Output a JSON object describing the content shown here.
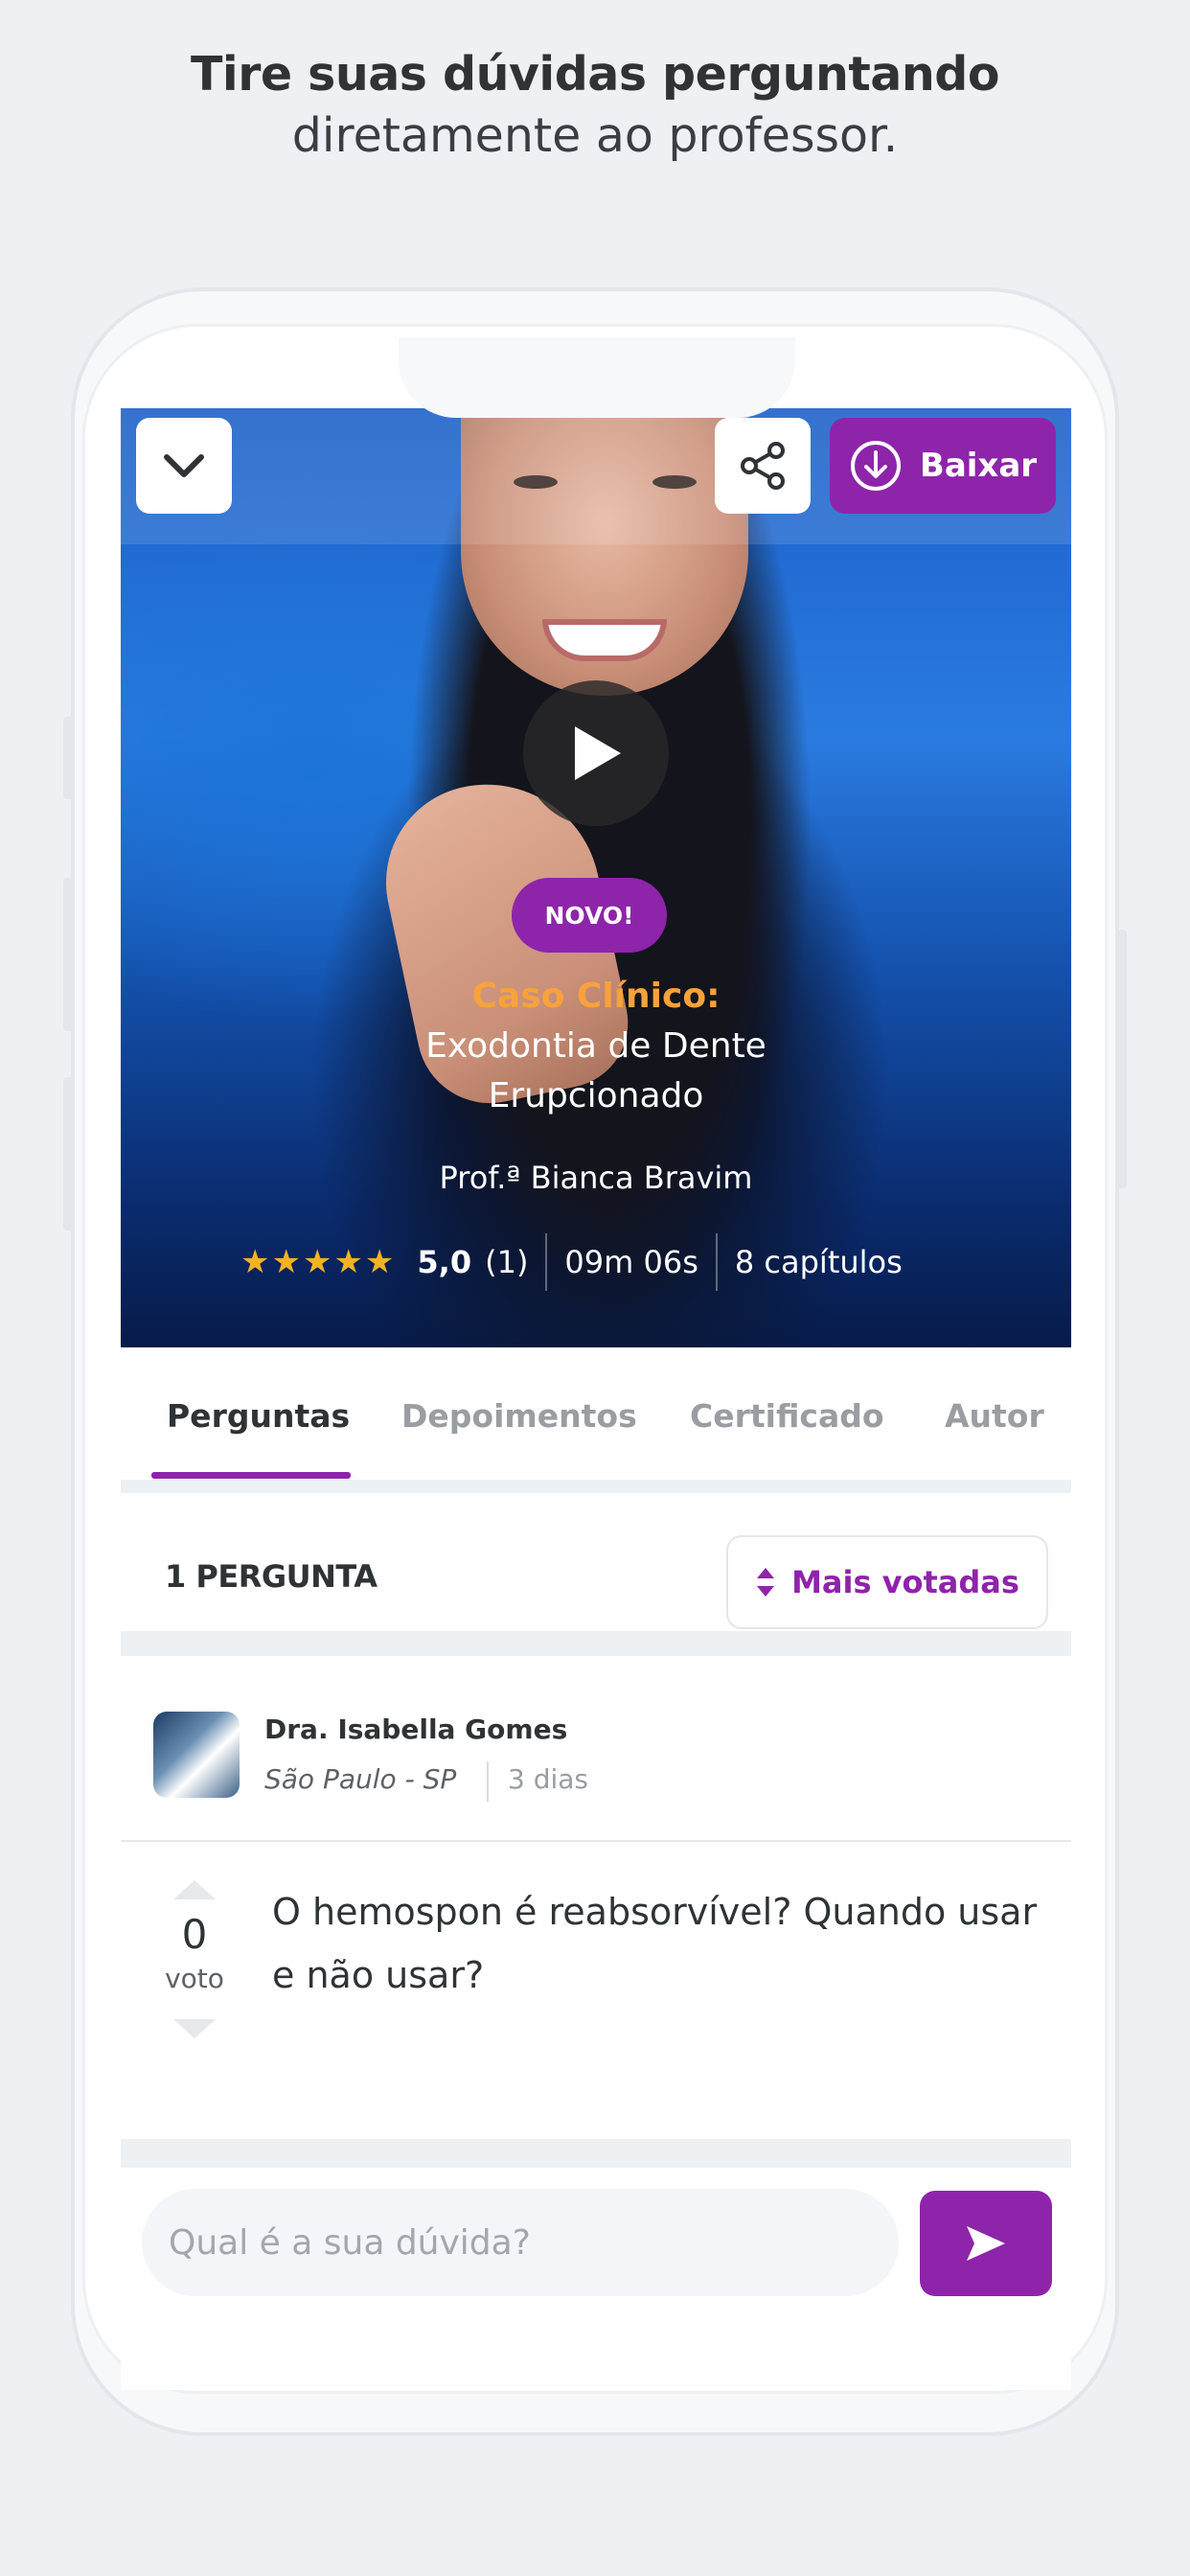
{
  "headline": {
    "line1": "Tire suas dúvidas perguntando",
    "line2": "diretamente ao professor."
  },
  "hero": {
    "download_label": "Baixar",
    "badge": "NOVO!",
    "title_kicker": "Caso Clínico:",
    "title_line1": "Exodontia de Dente",
    "title_line2": "Erupcionado",
    "professor": "Prof.ª Bianca Bravim",
    "stars": "★★★★★",
    "rating": "5,0",
    "rating_count": "(1)",
    "duration": "09m 06s",
    "chapters": "8 capítulos"
  },
  "tabs": {
    "items": [
      {
        "label": "Perguntas",
        "active": true
      },
      {
        "label": "Depoimentos",
        "active": false
      },
      {
        "label": "Certificado",
        "active": false
      },
      {
        "label": "Autor",
        "active": false
      }
    ]
  },
  "questions": {
    "count_label": "1 PERGUNTA",
    "sort_label": "Mais votadas"
  },
  "post": {
    "author_name": "Dra. Isabella Gomes",
    "author_location": "São Paulo - SP",
    "posted_ago": "3 dias",
    "votes": "0",
    "votes_label": "voto",
    "text": "O hemospon é reabsorvível? Quando usar e não usar?"
  },
  "composer": {
    "placeholder": "Qual é a sua dúvida?"
  },
  "colors": {
    "accent": "#8e24aa",
    "kicker": "#f7a23b",
    "stars": "#f5b324",
    "background": "#eef1f4"
  },
  "icons": [
    "chevron-down-icon",
    "share-icon",
    "download-icon",
    "play-icon",
    "sort-icon",
    "send-icon",
    "vote-up-icon",
    "vote-down-icon"
  ]
}
